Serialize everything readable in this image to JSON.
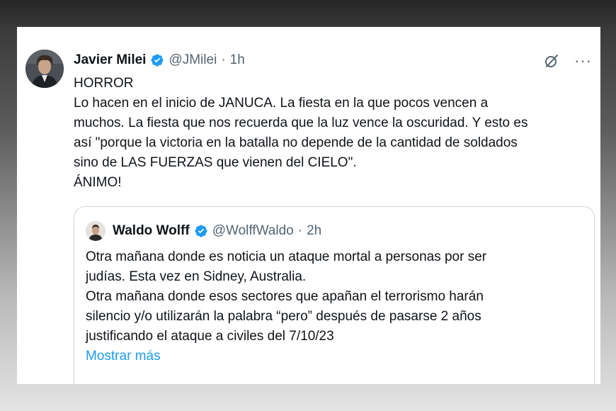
{
  "tweet": {
    "author_name": "Javier Milei",
    "handle": "@JMilei",
    "separator": "·",
    "time": "1h",
    "more": "···",
    "lines": [
      "HORROR",
      "Lo hacen en el inicio de JANUCA. La fiesta en la que pocos vencen a",
      "muchos. La fiesta que nos recuerda que la luz vence la oscuridad. Y esto es",
      "así \"porque la victoria en la batalla no depende de la cantidad de soldados",
      "sino de LAS FUERZAS que vienen del CIELO\".",
      "ÁNIMO!"
    ]
  },
  "quoted": {
    "author_name": "Waldo Wolff",
    "handle": "@WolffWaldo",
    "separator": "·",
    "time": "2h",
    "lines": [
      "Otra mañana donde es noticia un ataque mortal a personas por ser",
      "judías. Esta vez en Sidney, Australia.",
      "Otra mañana donde esos sectores que apañan el terrorismo harán",
      "silencio y/o utilizarán la palabra “pero” después de pasarse 2 años",
      "justificando el ataque a civiles del 7/10/23"
    ],
    "show_more": "Mostrar más"
  },
  "colors": {
    "verified": "#1d9bf0",
    "link": "#1d9bf0",
    "secondary_text": "#536471",
    "primary_text": "#0f1419"
  },
  "icons": [
    "verified-badge-icon",
    "grok-icon",
    "more-options-icon"
  ]
}
